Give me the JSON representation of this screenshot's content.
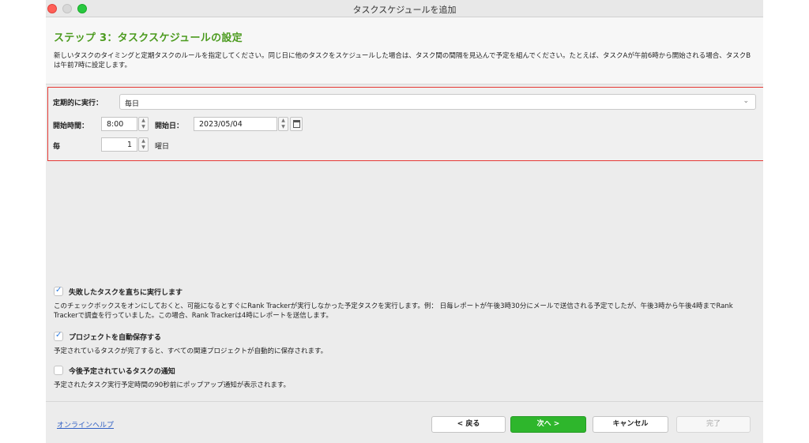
{
  "window": {
    "title": "タスクスケジュールを追加"
  },
  "header": {
    "step_title": "ステップ 3：タスクスケジュールの設定",
    "description": "新しいタスクのタイミングと定期タスクのルールを指定してください。同じ日に他のタスクをスケジュールした場合は、タスク間の間隔を見込んで予定を組んでください。たとえば、タスクAが午前6時から開始される場合、タスクBは午前7時に設定します。"
  },
  "schedule": {
    "periodic_label": "定期的に実行：",
    "periodic_value": "毎日",
    "start_time_label": "開始時間：",
    "start_time_value": "8:00",
    "start_date_label": "開始日：",
    "start_date_value": "2023/05/04",
    "every_label": "毎",
    "every_value": "1",
    "every_unit": "曜日"
  },
  "options": [
    {
      "label": "失敗したタスクを直ちに実行します",
      "checked": true,
      "description": "このチェックボックスをオンにしておくと、可能になるとすぐにRank Trackerが実行しなかった予定タスクを実行します。例： 日毎レポートが午後3時30分にメールで送信される予定でしたが、午後3時から午後4時までRank Trackerで調査を行っていました。この場合、Rank Trackerは4時にレポートを送信します。"
    },
    {
      "label": "プロジェクトを自動保存する",
      "checked": true,
      "description": "予定されているタスクが完了すると、すべての関連プロジェクトが自動的に保存されます。"
    },
    {
      "label": "今後予定されているタスクの通知",
      "checked": false,
      "description": "予定されたタスク実行予定時間の90秒前にポップアップ通知が表示されます。"
    }
  ],
  "footer": {
    "help_link": "オンラインヘルプ",
    "back": "< 戻る",
    "next": "次へ >",
    "cancel": "キャンセル",
    "finish": "完了"
  },
  "colors": {
    "accent_green": "#4c9b1f",
    "next_button": "#2eb62c",
    "highlight_border": "#e53935",
    "checkbox_check": "#2f7de1"
  }
}
